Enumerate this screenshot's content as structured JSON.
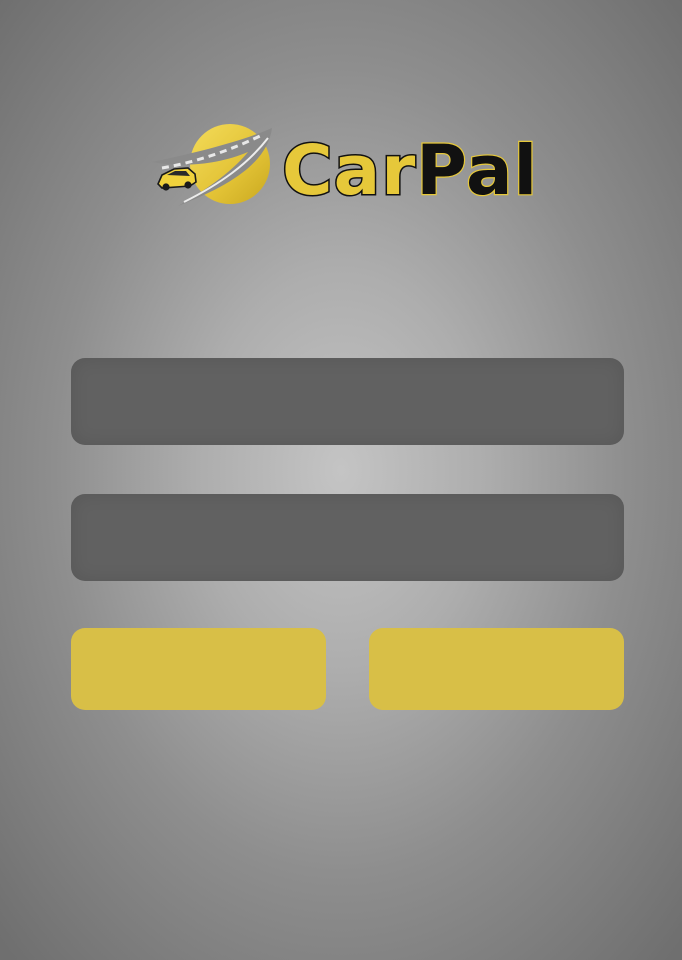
{
  "app": {
    "logo_text": "CarPal",
    "logo_text_part1": "Car",
    "logo_text_part2": "Pal",
    "logo_icon": "planet-road-car-icon"
  },
  "form": {
    "field_1": {
      "value": "",
      "placeholder": ""
    },
    "field_2": {
      "value": "",
      "placeholder": ""
    }
  },
  "buttons": {
    "left_label": "",
    "right_label": ""
  },
  "colors": {
    "brand_yellow": "#e6c83a",
    "field_background": "#616161",
    "button_background": "#d8bf47",
    "background_center": "#c4c4c4",
    "background_edge": "#6f6f6f"
  }
}
